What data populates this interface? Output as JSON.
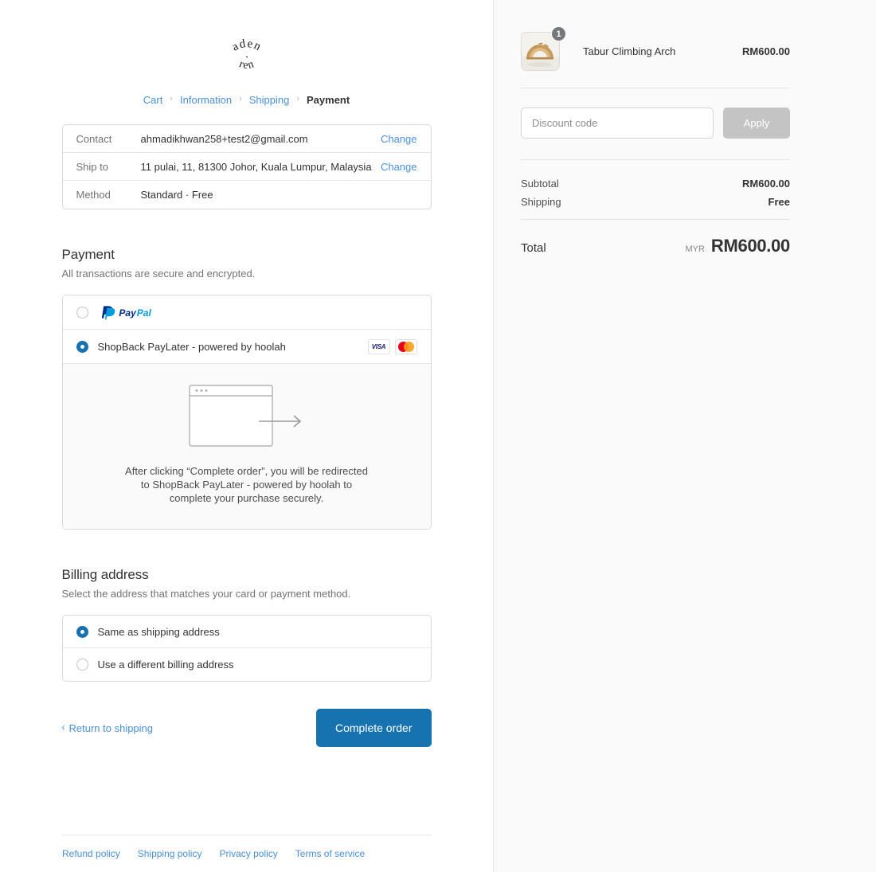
{
  "brand": {
    "logo_line1": "aden",
    "logo_line2": "ren",
    "logo_alt": "aden + ren"
  },
  "breadcrumb": {
    "items": [
      {
        "label": "Cart",
        "current": false
      },
      {
        "label": "Information",
        "current": false
      },
      {
        "label": "Shipping",
        "current": false
      },
      {
        "label": "Payment",
        "current": true
      }
    ],
    "separator": "›"
  },
  "review": {
    "rows": [
      {
        "label": "Contact",
        "value": "ahmadikhwan258+test2@gmail.com",
        "action": "Change"
      },
      {
        "label": "Ship to",
        "value": "11 pulai, 11, 81300 Johor, Kuala Lumpur, Malaysia",
        "action": "Change"
      },
      {
        "label": "Method",
        "value": "Standard · Free",
        "action": ""
      }
    ]
  },
  "payment": {
    "title": "Payment",
    "subtitle": "All transactions are secure and encrypted.",
    "methods": [
      {
        "id": "paypal",
        "label": "PayPal",
        "selected": false,
        "logo": "paypal-logo"
      },
      {
        "id": "shopback",
        "label": "ShopBack PayLater - powered by hoolah",
        "selected": true,
        "logo": "card-badges"
      }
    ],
    "card_badges": [
      "visa-logo",
      "mastercard-logo"
    ],
    "redirect_notice": "After clicking “Complete order”, you will be redirected to ShopBack PayLater - powered by hoolah to complete your purchase securely."
  },
  "billing": {
    "title": "Billing address",
    "subtitle": "Select the address that matches your card or payment method.",
    "options": [
      {
        "label": "Same as shipping address",
        "selected": true
      },
      {
        "label": "Use a different billing address",
        "selected": false
      }
    ]
  },
  "actions": {
    "return_label": "Return to shipping",
    "return_chevron": "‹",
    "complete_label": "Complete order",
    "complete_color": "#1773b0"
  },
  "footer": {
    "links": [
      "Refund policy",
      "Shipping policy",
      "Privacy policy",
      "Terms of service"
    ]
  },
  "summary": {
    "item": {
      "name": "Tabur Climbing Arch",
      "price": "RM600.00",
      "quantity": "1",
      "image_alt": "wooden-climbing-arch-photo"
    },
    "discount": {
      "placeholder": "Discount code",
      "value": "",
      "apply_label": "Apply",
      "apply_disabled": true
    },
    "lines": [
      {
        "label": "Subtotal",
        "value": "RM600.00"
      },
      {
        "label": "Shipping",
        "value": "Free"
      }
    ],
    "total": {
      "label": "Total",
      "currency": "MYR",
      "amount": "RM600.00"
    }
  }
}
